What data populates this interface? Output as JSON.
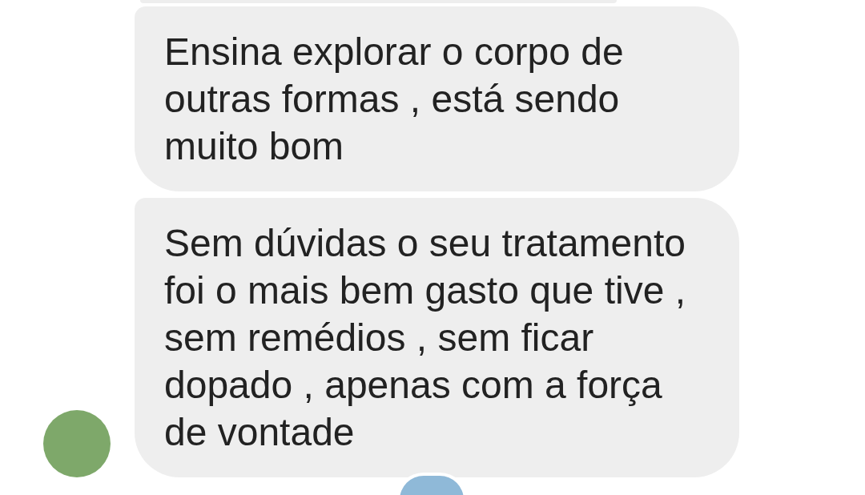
{
  "messages": [
    {
      "text": "Ensina explorar o corpo de outras formas , está sendo muito bom",
      "show_avatar": false
    },
    {
      "text": "Sem dúvidas o seu tratamento foi o mais bem gasto que tive , sem remédios , sem ficar dopado , apenas com a força de vontade",
      "show_avatar": true
    }
  ],
  "read_receipt": {
    "shown": true
  }
}
